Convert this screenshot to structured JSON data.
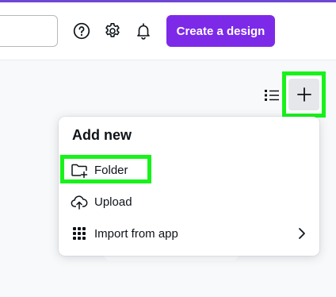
{
  "header": {
    "search": {
      "placeholder": ""
    },
    "icons": [
      "help-icon",
      "gear-icon",
      "bell-icon"
    ],
    "create_button_label": "Create a design"
  },
  "toolbar": {
    "list_view_icon": "list-view-icon",
    "add_icon": "plus-icon"
  },
  "dropdown": {
    "title": "Add new",
    "items": [
      {
        "label": "Folder",
        "icon": "folder-plus-icon",
        "highlighted": true
      },
      {
        "label": "Upload",
        "icon": "cloud-upload-icon"
      },
      {
        "label": "Import from app",
        "icon": "apps-grid-icon",
        "has_submenu": true
      }
    ]
  },
  "colors": {
    "brand_purple": "#7d2ae8",
    "top_accent": "#6f47d6",
    "highlight_green": "#18f21b",
    "text": "#0e1318"
  }
}
